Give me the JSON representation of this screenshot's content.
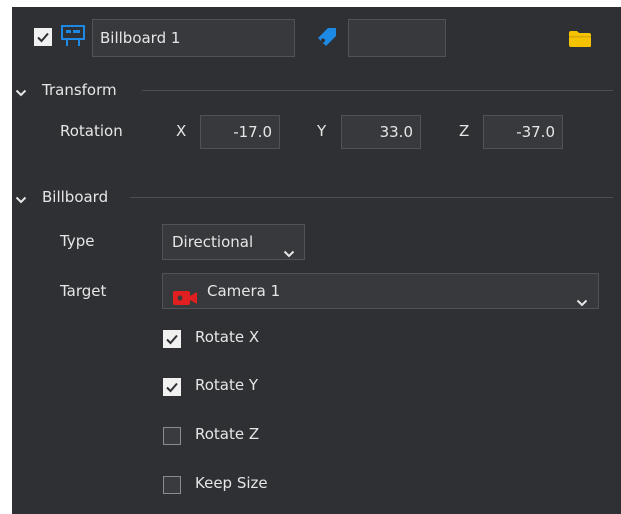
{
  "header": {
    "enabled": true,
    "name_value": "Billboard 1",
    "tag_value": "",
    "icons": {
      "object": "billboard-icon",
      "tag": "tag-icon",
      "folder": "folder-icon"
    }
  },
  "transform": {
    "title": "Transform",
    "rotation_label": "Rotation",
    "x_label": "X",
    "y_label": "Y",
    "z_label": "Z",
    "x_value": "-17.0",
    "y_value": "33.0",
    "z_value": "-37.0"
  },
  "billboard": {
    "title": "Billboard",
    "type_label": "Type",
    "type_value": "Directional",
    "target_label": "Target",
    "target_value": "Camera 1",
    "checkboxes": [
      {
        "label": "Rotate X",
        "checked": true
      },
      {
        "label": "Rotate Y",
        "checked": true
      },
      {
        "label": "Rotate Z",
        "checked": false
      },
      {
        "label": "Keep Size",
        "checked": false
      }
    ]
  },
  "colors": {
    "panel_bg": "#2f3033",
    "field_bg": "#38393c",
    "accent_blue": "#1e88e5",
    "folder_yellow": "#f5c200",
    "camera_red": "#e02020"
  }
}
